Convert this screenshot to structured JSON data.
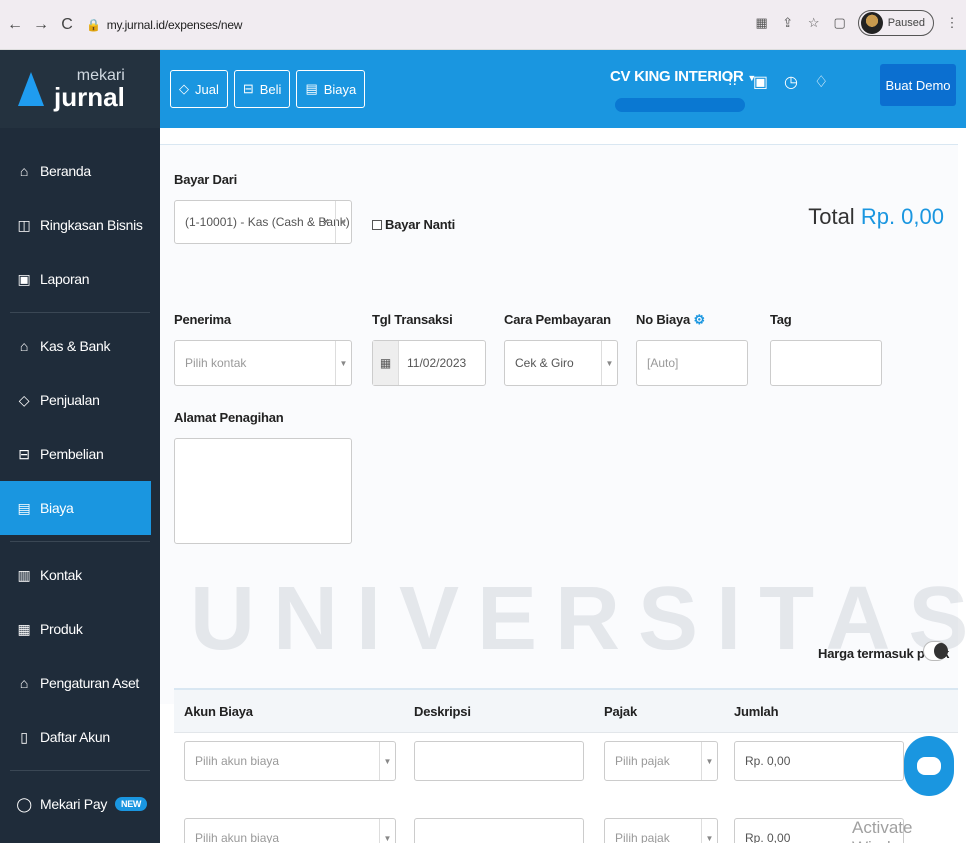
{
  "browser": {
    "url": "my.jurnal.id/expenses/new",
    "paused_label": "Paused"
  },
  "brand": {
    "small": "mekari",
    "big": "jurnal"
  },
  "sidebar": {
    "items": [
      {
        "label": "Beranda",
        "icon": "home-icon"
      },
      {
        "label": "Ringkasan Bisnis",
        "icon": "chart-icon"
      },
      {
        "label": "Laporan",
        "icon": "report-icon"
      },
      {
        "label": "Kas & Bank",
        "icon": "bank-icon"
      },
      {
        "label": "Penjualan",
        "icon": "tag-icon"
      },
      {
        "label": "Pembelian",
        "icon": "cart-icon"
      },
      {
        "label": "Biaya",
        "icon": "expense-icon"
      },
      {
        "label": "Kontak",
        "icon": "contact-icon"
      },
      {
        "label": "Produk",
        "icon": "product-icon"
      },
      {
        "label": "Pengaturan Aset",
        "icon": "asset-icon"
      },
      {
        "label": "Daftar Akun",
        "icon": "accounts-icon"
      },
      {
        "label": "Mekari Pay",
        "icon": "pay-icon"
      }
    ],
    "new_badge": "NEW"
  },
  "topbar": {
    "jual": "Jual",
    "beli": "Beli",
    "biaya": "Biaya",
    "company": "CV KING INTERIOR",
    "demo": "Buat Demo"
  },
  "form": {
    "bayar_dari_label": "Bayar Dari",
    "bayar_dari_value": "(1-10001) - Kas (Cash & Bank)",
    "bayar_nanti": "Bayar Nanti",
    "total_label": "Total",
    "total_value": "Rp. 0,00",
    "penerima_label": "Penerima",
    "penerima_placeholder": "Pilih kontak",
    "tgl_label": "Tgl Transaksi",
    "tgl_value": "11/02/2023",
    "cara_label": "Cara Pembayaran",
    "cara_value": "Cek & Giro",
    "no_biaya_label": "No Biaya",
    "no_biaya_placeholder": "[Auto]",
    "tag_label": "Tag",
    "alamat_label": "Alamat Penagihan",
    "harga_pajak": "Harga termasuk pajak"
  },
  "table": {
    "headers": [
      "Akun Biaya",
      "Deskripsi",
      "Pajak",
      "Jumlah"
    ],
    "rows": [
      {
        "akun": "Pilih akun biaya",
        "pajak": "Pilih pajak",
        "jumlah": "Rp. 0,00"
      },
      {
        "akun": "Pilih akun biaya",
        "pajak": "Pilih pajak",
        "jumlah": "Rp. 0,00"
      }
    ]
  },
  "watermark": "UNIVERSITAS",
  "activate_windows": "Activate Windows"
}
